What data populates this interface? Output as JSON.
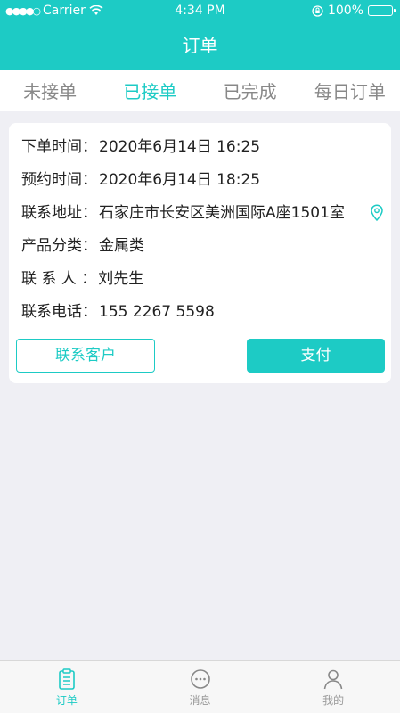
{
  "status_bar": {
    "carrier": "Carrier",
    "time": "4:34 PM",
    "battery": "100%"
  },
  "nav": {
    "title": "订单"
  },
  "tabs": [
    {
      "label": "未接单",
      "active": false
    },
    {
      "label": "已接单",
      "active": true
    },
    {
      "label": "已完成",
      "active": false
    },
    {
      "label": "每日订单",
      "active": false
    }
  ],
  "order": {
    "rows": [
      {
        "label": "下单时间：",
        "value": "2020年6月14日 16:25"
      },
      {
        "label": "预约时间：",
        "value": "2020年6月14日 18:25"
      },
      {
        "label": "联系地址：",
        "value": "石家庄市长安区美洲国际A座1501室"
      },
      {
        "label": "产品分类：",
        "value": "金属类"
      },
      {
        "label": "联 系 人 ：",
        "value": "刘先生"
      },
      {
        "label": "联系电话：",
        "value": "155 2267 5598"
      }
    ],
    "contact_button": "联系客户",
    "pay_button": "支付"
  },
  "tab_bar": [
    {
      "label": "订单",
      "icon": "order-icon",
      "active": true
    },
    {
      "label": "消息",
      "icon": "message-icon",
      "active": false
    },
    {
      "label": "我的",
      "icon": "profile-icon",
      "active": false
    }
  ],
  "colors": {
    "accent": "#1dcbc5",
    "background": "#efeff4"
  }
}
